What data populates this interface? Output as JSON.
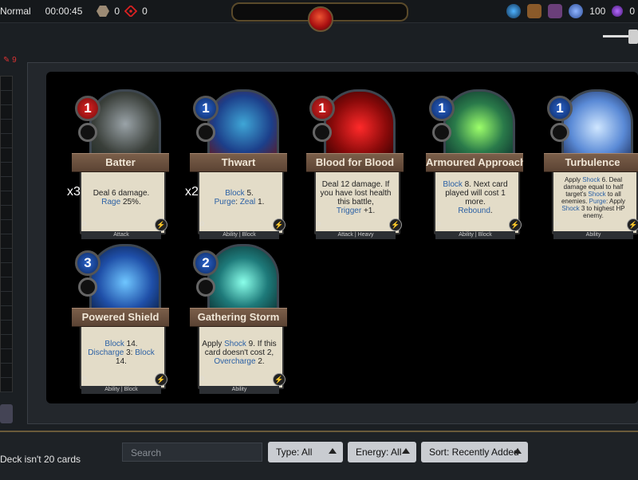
{
  "topbar": {
    "mode": "Normal",
    "timer": "00:00:45",
    "resource1": "0",
    "resource2": "0",
    "currency1": "100",
    "currency2": "0"
  },
  "left": {
    "tag": "9"
  },
  "cards": [
    {
      "name": "Batter",
      "cost": "1",
      "type": "Attack",
      "multiplier": "x3",
      "desc_pre": "Deal 6 damage.",
      "kw1": "Rage",
      "desc_post": "25%."
    },
    {
      "name": "Thwart",
      "cost": "1",
      "type": "Ability | Block",
      "multiplier": "x2",
      "kw1": "Block",
      "desc_post": "5.",
      "kw2": "Purge",
      "sep": ":",
      "kw3": "Zeal",
      "desc_end": "1."
    },
    {
      "name": "Blood for Blood",
      "cost": "1",
      "type": "Attack | Heavy",
      "desc_pre": "Deal 12 damage. If you have lost health this battle,",
      "kw1": "Trigger",
      "desc_post": "+1."
    },
    {
      "name": "Armoured Approach",
      "cost": "1",
      "type": "Ability | Block",
      "kw1": "Block",
      "desc_post": "8. Next card played will cost 1 more.",
      "kw2": "Rebound",
      "desc_end": "."
    },
    {
      "name": "Turbulence",
      "cost": "1",
      "type": "Ability",
      "desc_pre": "Apply",
      "kw1": "Shock",
      "desc_post": "6. Deal damage equal to half target's",
      "kw2": "Shock",
      "desc_mid": "to all enemies.",
      "kw3": "Purge",
      "desc_mid2": ": Apply",
      "kw4": "Shock",
      "desc_end": "3 to highest HP enemy."
    },
    {
      "name": "Powered Shield",
      "cost": "3",
      "type": "Ability | Block",
      "kw1": "Block",
      "desc_post": "14.",
      "kw2": "Discharge",
      "desc_mid": "3:",
      "kw3": "Block",
      "desc_end": "14."
    },
    {
      "name": "Gathering Storm",
      "cost": "2",
      "type": "Ability",
      "desc_pre": "Apply",
      "kw1": "Shock",
      "desc_post": "9. If this card doesn't cost 2,",
      "kw2": "Overcharge",
      "desc_end": "2."
    }
  ],
  "bottom": {
    "deck_msg": "Deck isn't 20 cards",
    "search_placeholder": "Search",
    "type_filter": "Type: All",
    "energy_filter": "Energy: All",
    "sort": "Sort: Recently Added"
  },
  "colors": {
    "keyword": "#2c61a5",
    "cost_red": "#c21b1b",
    "cost_blue": "#1f4fa8",
    "accent_gold": "#6a5a3a"
  }
}
